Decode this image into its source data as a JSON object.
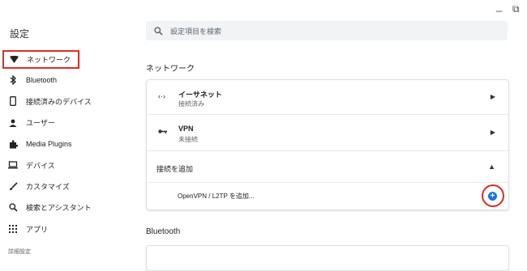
{
  "window": {
    "minimize_glyph": "_",
    "restore_glyph": "⧉"
  },
  "app": {
    "title": "設定"
  },
  "sidebar": {
    "items": [
      {
        "label": "ネットワーク",
        "icon": "wifi-icon",
        "selected": true
      },
      {
        "label": "Bluetooth",
        "icon": "bluetooth-icon"
      },
      {
        "label": "接続済みのデバイス",
        "icon": "phone-icon"
      },
      {
        "label": "ユーザー",
        "icon": "person-icon"
      },
      {
        "label": "Media Plugins",
        "icon": "puzzle-icon"
      },
      {
        "label": "デバイス",
        "icon": "laptop-icon"
      },
      {
        "label": "カスタマイズ",
        "icon": "brush-icon"
      },
      {
        "label": "検索とアシスタント",
        "icon": "search-icon"
      },
      {
        "label": "アプリ",
        "icon": "apps-grid-icon"
      }
    ],
    "footer": "詳細設定"
  },
  "search": {
    "placeholder": "設定項目を検索"
  },
  "network": {
    "heading": "ネットワーク",
    "ethernet": {
      "title": "イーサネット",
      "status": "接続済み"
    },
    "vpn": {
      "title": "VPN",
      "status": "未接続"
    },
    "add_connection": {
      "label": "接続を追加",
      "item": "OpenVPN / L2TP を追加..."
    }
  },
  "bluetooth": {
    "heading": "Bluetooth"
  },
  "colors": {
    "accent": "#1a73e8",
    "highlight": "#d93025"
  }
}
